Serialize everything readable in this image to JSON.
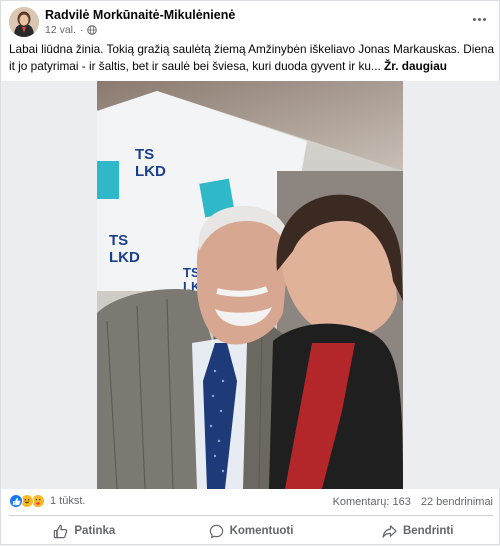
{
  "post": {
    "author": "Radvilė Morkūnaitė-Mikulėnienė",
    "time": "12 val.",
    "text": "Labai liūdna žinia. Tokią gražią saulėtą žiemą Amžinybėn iškeliavo Jonas Markauskas. Diena it jo patyrimai - ir šaltis, bet ir saulė bei šviesa, kuri duoda gyvent ir ku...",
    "see_more": "Žr. daugiau"
  },
  "photo": {
    "banner_text": [
      "TS",
      "LKD"
    ]
  },
  "stats": {
    "reactions_count": "1 tūkst.",
    "comments": "Komentarų: 163",
    "shares": "22 bendrinimai"
  },
  "actions": {
    "like": "Patinka",
    "comment": "Komentuoti",
    "share": "Bendrinti"
  },
  "icons": {
    "privacy": "globe-icon",
    "more": "more-dots-icon",
    "reactions": [
      "like-icon",
      "haha-icon",
      "care-icon"
    ]
  },
  "colors": {
    "like_blue": "#1877f2",
    "emoji_yellow": "#f7b928",
    "banner_teal": "#2fb8c7",
    "banner_navy": "#1b3f8f",
    "secondary_text": "#65676b"
  }
}
